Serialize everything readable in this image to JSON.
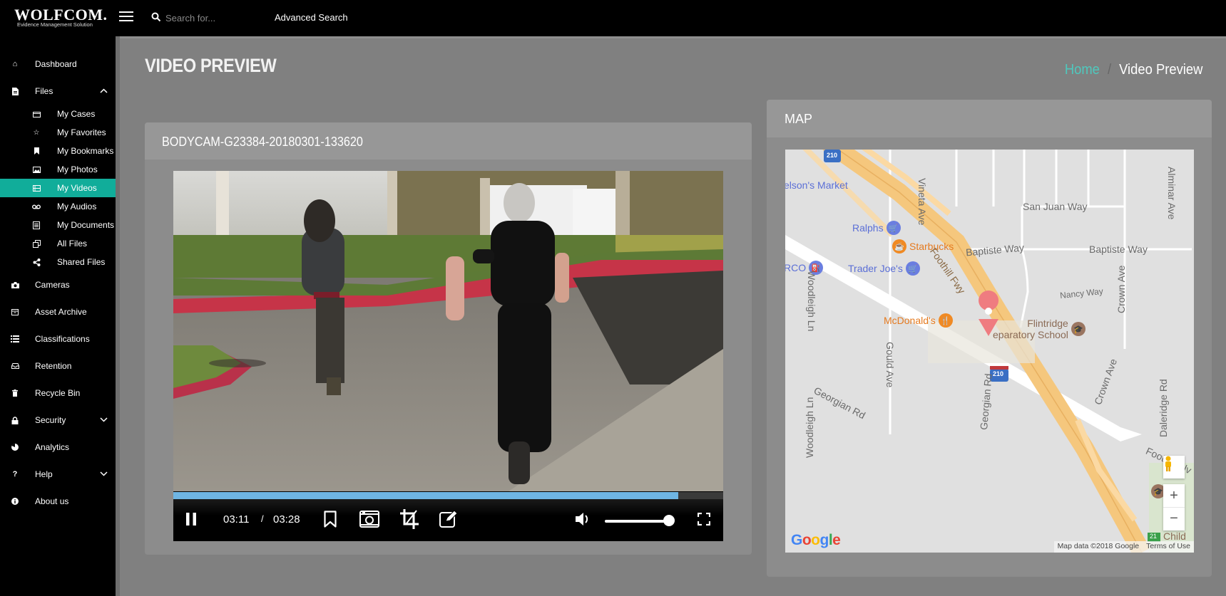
{
  "header": {
    "brand": "WOLFCOM.",
    "tagline": "Evidence Management Solution",
    "search_placeholder": "Search for...",
    "advanced_search": "Advanced Search"
  },
  "sidebar": {
    "items": [
      {
        "label": "Dashboard",
        "icon": "home-icon"
      },
      {
        "label": "Files",
        "icon": "file-icon",
        "chevron": "up"
      },
      {
        "label": "Cameras",
        "icon": "camera-icon"
      },
      {
        "label": "Asset Archive",
        "icon": "archive-icon"
      },
      {
        "label": "Classifications",
        "icon": "list-icon"
      },
      {
        "label": "Retention",
        "icon": "inbox-icon"
      },
      {
        "label": "Recycle Bin",
        "icon": "trash-icon"
      },
      {
        "label": "Security",
        "icon": "lock-icon",
        "chevron": "down"
      },
      {
        "label": "Analytics",
        "icon": "pie-chart-icon"
      },
      {
        "label": "Help",
        "icon": "question-icon",
        "chevron": "down"
      },
      {
        "label": "About us",
        "icon": "info-icon"
      }
    ],
    "files_sub": [
      {
        "label": "My Cases",
        "icon": "briefcase-icon"
      },
      {
        "label": "My Favorites",
        "icon": "star-icon"
      },
      {
        "label": "My Bookmarks",
        "icon": "bookmark-icon"
      },
      {
        "label": "My Photos",
        "icon": "image-icon"
      },
      {
        "label": "My Videos",
        "icon": "film-icon",
        "active": true
      },
      {
        "label": "My Audios",
        "icon": "audio-icon"
      },
      {
        "label": "My Documents",
        "icon": "document-icon"
      },
      {
        "label": "All Files",
        "icon": "copy-icon"
      },
      {
        "label": "Shared Files",
        "icon": "share-icon"
      }
    ]
  },
  "page": {
    "title": "VIDEO PREVIEW",
    "breadcrumb": {
      "home": "Home",
      "separator": "/",
      "current": "Video Preview"
    }
  },
  "video": {
    "title": "BODYCAM-G23384-20180301-133620",
    "current_time": "03:11",
    "separator": "/",
    "duration": "03:28",
    "progress_fraction": 0.918,
    "volume_fraction": 1.0,
    "playing": true
  },
  "map": {
    "title": "MAP",
    "labels": {
      "nelsons_market": "elson's Market",
      "ralphs": "Ralphs",
      "starbucks": "Starbucks",
      "arco": "RCO",
      "trader_joes": "Trader Joe's",
      "mcdonalds": "McDonald's",
      "school_line1": "Flintridge",
      "school_line2": "eparatory School",
      "san_juan": "San Juan Way",
      "baptiste_1": "Baptiste Way",
      "baptiste_2": "Baptiste Way",
      "nancy": "Nancy Way",
      "vineta": "Vineta Ave",
      "alminar": "Alminar Ave",
      "crown_1": "Crown Ave",
      "crown_2": "Crown Ave",
      "foothill": "Foothill Fwy",
      "woodleigh_1": "Woodleigh Ln",
      "woodleigh_2": "Woodleigh Ln",
      "gould": "Gould Ave",
      "georgian_1": "Georgian Rd",
      "georgian_2": "Georgian Rd",
      "daleridge": "Daleridge Rd",
      "foothill_blvd": "Foothill Blv",
      "child": "Child",
      "route_210": "210",
      "route_21": "21"
    },
    "google": "Google",
    "map_data": "Map data ©2018 Google",
    "terms": "Terms of Use",
    "zoom_in": "+",
    "zoom_out": "−"
  }
}
